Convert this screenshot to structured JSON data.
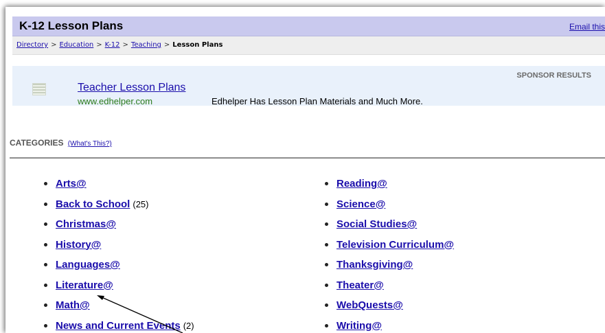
{
  "header": {
    "title": "K-12 Lesson Plans",
    "email_link": "Email this"
  },
  "breadcrumb": {
    "items": [
      "Directory",
      "Education",
      "K-12",
      "Teaching"
    ],
    "separator": ">",
    "current": "Lesson Plans"
  },
  "sponsor": {
    "label": "SPONSOR RESULTS",
    "title": "Teacher Lesson Plans",
    "url": "www.edhelper.com",
    "description": "Edhelper Has Lesson Plan Materials and Much More."
  },
  "categories": {
    "heading": "CATEGORIES",
    "whats_this": "(What's This?)",
    "left": [
      {
        "label": "Arts@",
        "count": ""
      },
      {
        "label": "Back to School",
        "count": "(25)"
      },
      {
        "label": "Christmas@",
        "count": ""
      },
      {
        "label": "History@",
        "count": ""
      },
      {
        "label": "Languages@",
        "count": ""
      },
      {
        "label": "Literature@",
        "count": ""
      },
      {
        "label": "Math@",
        "count": ""
      },
      {
        "label": "News and Current Events",
        "count": "(2)"
      }
    ],
    "right": [
      {
        "label": "Reading@",
        "count": ""
      },
      {
        "label": "Science@",
        "count": ""
      },
      {
        "label": "Social Studies@",
        "count": ""
      },
      {
        "label": "Television Curriculum@",
        "count": ""
      },
      {
        "label": "Thanksgiving@",
        "count": ""
      },
      {
        "label": "Theater@",
        "count": ""
      },
      {
        "label": "WebQuests@",
        "count": ""
      },
      {
        "label": "Writing@",
        "count": ""
      }
    ]
  },
  "colors": {
    "header_bg": "#c9c9ee",
    "link": "#1a0dab",
    "sponsor_bg": "#e9f1fb",
    "url_green": "#2a7a1a"
  }
}
